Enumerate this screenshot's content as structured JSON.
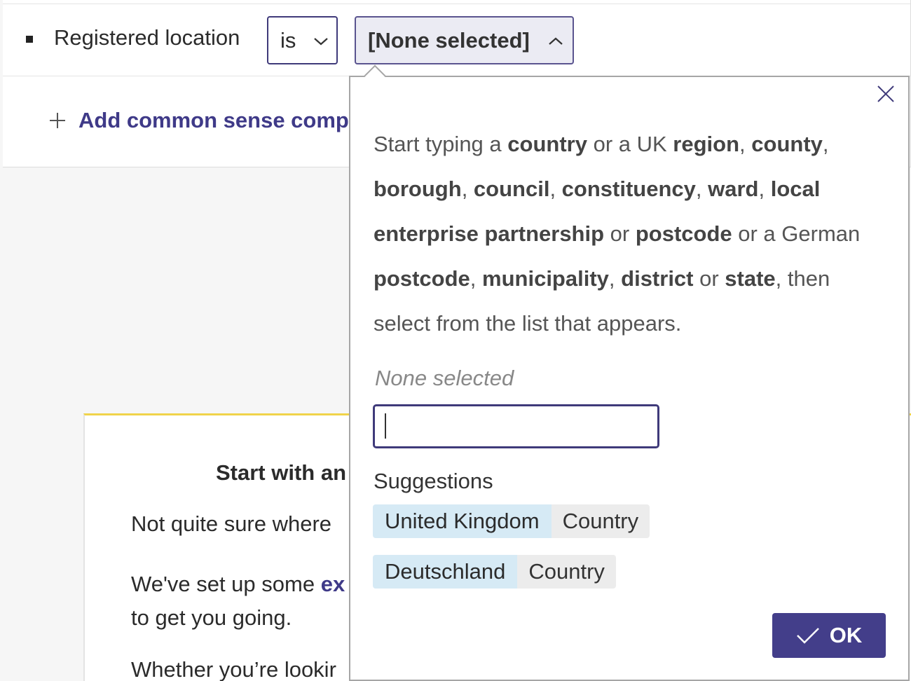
{
  "filter": {
    "label": "Registered location",
    "operator": "is",
    "value_button": "[None selected]",
    "add_link": "Add common sense compa"
  },
  "info_card": {
    "title": "Start with an",
    "p1": "Not quite sure where",
    "p2_before": "We've set up some",
    "p2_link": "ex",
    "p2_line2": "to get you going.",
    "p3": "Whether you’re lookir"
  },
  "popover": {
    "help": [
      {
        "t": "Start typing a ",
        "b": false
      },
      {
        "t": "country",
        "b": true
      },
      {
        "t": " or a UK ",
        "b": false
      },
      {
        "t": "region",
        "b": true
      },
      {
        "t": ", ",
        "b": false
      },
      {
        "t": "county",
        "b": true
      },
      {
        "t": ", ",
        "b": false
      },
      {
        "t": "borough",
        "b": true
      },
      {
        "t": ", ",
        "b": false
      },
      {
        "t": "council",
        "b": true
      },
      {
        "t": ", ",
        "b": false
      },
      {
        "t": "constituency",
        "b": true
      },
      {
        "t": ", ",
        "b": false
      },
      {
        "t": "ward",
        "b": true
      },
      {
        "t": ", ",
        "b": false
      },
      {
        "t": "local enterprise partnership",
        "b": true
      },
      {
        "t": " or ",
        "b": false
      },
      {
        "t": "postcode",
        "b": true
      },
      {
        "t": " or a German ",
        "b": false
      },
      {
        "t": "postcode",
        "b": true
      },
      {
        "t": ", ",
        "b": false
      },
      {
        "t": "municipality",
        "b": true
      },
      {
        "t": ", ",
        "b": false
      },
      {
        "t": "district",
        "b": true
      },
      {
        "t": " or ",
        "b": false
      },
      {
        "t": "state",
        "b": true
      },
      {
        "t": ", then select from the list that appears.",
        "b": false
      }
    ],
    "none_selected": "None selected",
    "input_value": "",
    "suggestions_label": "Suggestions",
    "suggestions": [
      {
        "name": "United Kingdom",
        "type": "Country"
      },
      {
        "name": "Deutschland",
        "type": "Country"
      }
    ],
    "ok_label": "OK"
  },
  "colors": {
    "accent": "#433e8a",
    "chip_name_bg": "#d6eaf5",
    "chip_type_bg": "#ececec",
    "info_border": "#f0d34a"
  },
  "icons": {
    "close": "close-icon",
    "ok": "check-icon",
    "add": "plus-icon"
  }
}
